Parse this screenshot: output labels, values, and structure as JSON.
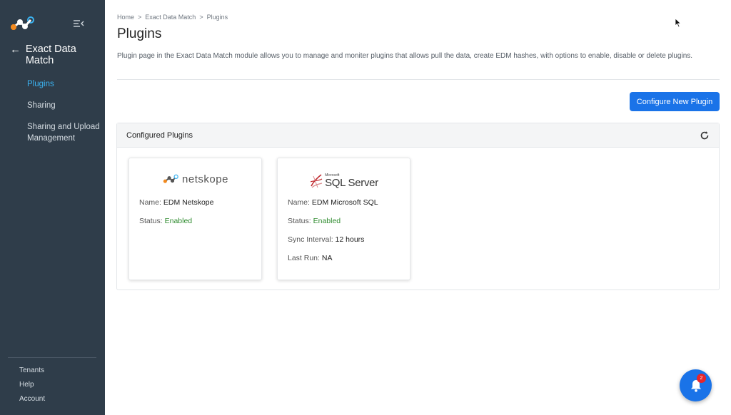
{
  "sidebar": {
    "logo_icon": "netskope-logo-icon",
    "collapse_icon": "menu-collapse-icon",
    "back_icon": "arrow-left-icon",
    "module_title": "Exact Data Match",
    "items": [
      {
        "label": "Plugins",
        "active": true
      },
      {
        "label": "Sharing",
        "active": false
      },
      {
        "label": "Sharing and Upload Management",
        "active": false
      }
    ],
    "bottom_links": [
      "Tenants",
      "Help",
      "Account"
    ],
    "active_color": "#3bb3f1",
    "bg_color": "#2f3d4a"
  },
  "breadcrumb": {
    "items": [
      "Home",
      "Exact Data Match",
      "Plugins"
    ],
    "separator": ">"
  },
  "page": {
    "title": "Plugins",
    "description": "Plugin page in the Exact Data Match module allows you to manage and moniter plugins that allows pull the data, create EDM hashes, with options to enable, disable or delete plugins."
  },
  "actions": {
    "configure_label": "Configure New Plugin",
    "accent_color": "#1a73e8"
  },
  "panel": {
    "title": "Configured Plugins",
    "refresh_icon": "refresh-icon"
  },
  "plugins": [
    {
      "logo_text": "netskope",
      "name_label": "Name:",
      "name": "EDM Netskope",
      "status_label": "Status:",
      "status": "Enabled"
    },
    {
      "logo_small": "Microsoft",
      "logo_text": "SQL Server",
      "name_label": "Name:",
      "name": "EDM Microsoft SQL",
      "status_label": "Status:",
      "status": "Enabled",
      "sync_label": "Sync Interval:",
      "sync": "12 hours",
      "lastrun_label": "Last Run:",
      "lastrun": "NA"
    }
  ],
  "notifications": {
    "count": "2",
    "icon": "bell-icon"
  }
}
